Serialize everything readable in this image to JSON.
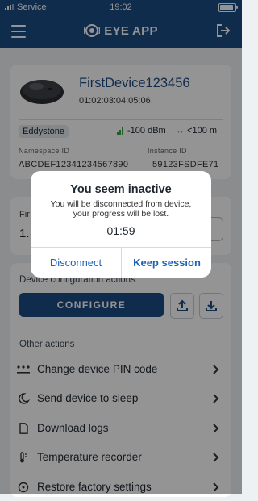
{
  "status_bar": {
    "carrier": "Service",
    "time": "19:02"
  },
  "header": {
    "app_title": "EYE APP"
  },
  "device": {
    "name": "FirstDevice123456",
    "mac": "01:02:03:04:05:06",
    "protocol": "Eddystone",
    "rssi": "-100 dBm",
    "range": "<100 m",
    "namespace_label": "Namespace ID",
    "namespace_value": "ABCDEF12341234567890",
    "instance_label": "Instance ID",
    "instance_value": "59123FSDFE71"
  },
  "firmware": {
    "label_partial": "Fir",
    "value_partial": "1."
  },
  "config": {
    "section_title": "Device configuration actions",
    "configure_label": "CONFIGURE"
  },
  "other": {
    "section_title": "Other actions",
    "actions": [
      {
        "label": "Change device PIN code",
        "icon": "dots-icon"
      },
      {
        "label": "Send device to sleep",
        "icon": "moon-icon"
      },
      {
        "label": "Download logs",
        "icon": "document-icon"
      },
      {
        "label": "Temperature recorder",
        "icon": "thermometer-icon"
      },
      {
        "label": "Restore factory settings",
        "icon": "restore-icon"
      }
    ]
  },
  "dialog": {
    "title": "You seem inactive",
    "message_line1": "You will be disconnected from device,",
    "message_line2": "your progress will be lost.",
    "timer": "01:59",
    "disconnect_label": "Disconnect",
    "keep_label": "Keep session"
  },
  "colors": {
    "primary": "#1d4c86",
    "link": "#1d63b8",
    "signal": "#3aa04a"
  }
}
